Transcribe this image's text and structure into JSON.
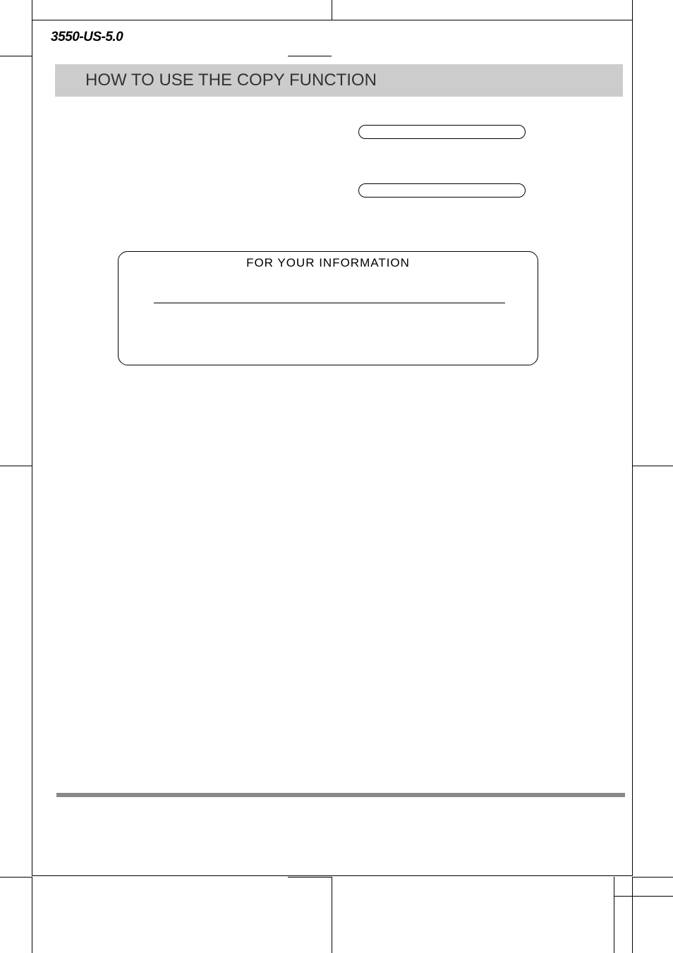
{
  "doc_id": "3550-US-5.0",
  "section_title": "HOW TO USE THE COPY FUNCTION",
  "info_box_title": "FOR  YOUR  INFORMATION"
}
